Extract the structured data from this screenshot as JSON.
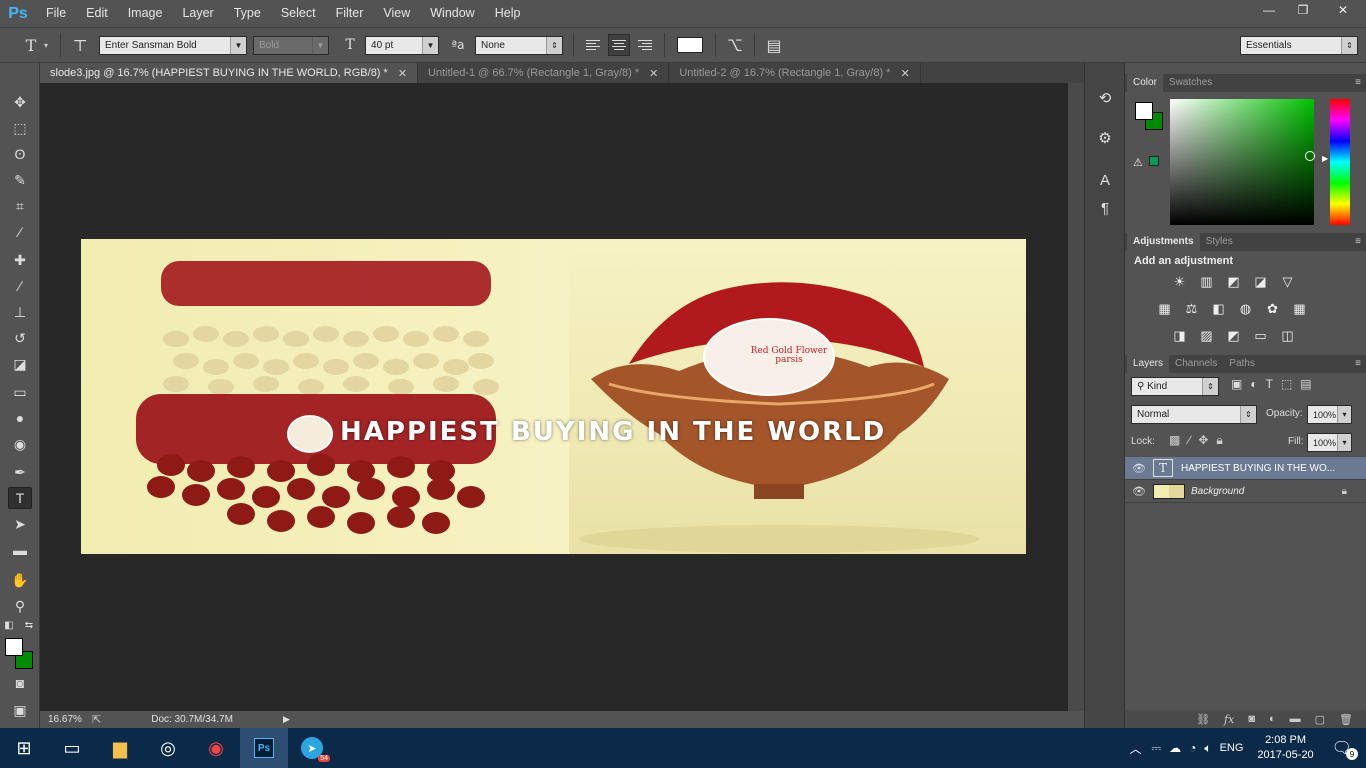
{
  "app": {
    "logo": "Ps"
  },
  "menu": [
    "File",
    "Edit",
    "Image",
    "Layer",
    "Type",
    "Select",
    "Filter",
    "View",
    "Window",
    "Help"
  ],
  "window_controls": {
    "minimize": "—",
    "restore": "❐",
    "close": "✕"
  },
  "options": {
    "font_family": "Enter Sansman Bold",
    "font_style": "Bold",
    "font_size": "40 pt",
    "anti_alias": "None",
    "workspace": "Essentials",
    "text_color": "#ffffff"
  },
  "tabs": [
    {
      "label": "slode3.jpg @ 16.7% (HAPPIEST BUYING IN THE WORLD, RGB/8) *",
      "close": "✕"
    },
    {
      "label": "Untitled-1 @ 66.7% (Rectangle 1, Gray/8) *",
      "close": "✕"
    },
    {
      "label": "Untitled-2 @ 16.7% (Rectangle 1, Gray/8) *",
      "close": "✕"
    }
  ],
  "document": {
    "headline": "HAPPIEST BUYING IN THE WORLD",
    "badge_text": "Red Gold Flower parsis"
  },
  "status": {
    "zoom": "16.67%",
    "doc": "Doc: 30.7M/34.7M"
  },
  "panels": {
    "color_tabs": [
      "Color",
      "Swatches"
    ],
    "adjust_tabs": [
      "Adjustments",
      "Styles"
    ],
    "adjust_title": "Add an adjustment",
    "layers_tabs": [
      "Layers",
      "Channels",
      "Paths"
    ],
    "kind": "Kind",
    "blend": "Normal",
    "opacity_label": "Opacity:",
    "opacity": "100%",
    "lock_label": "Lock:",
    "fill_label": "Fill:",
    "fill": "100%",
    "layers": [
      {
        "name": "HAPPIEST BUYING IN THE WO...",
        "type": "text"
      },
      {
        "name": "Background",
        "type": "image"
      }
    ]
  },
  "taskbar": {
    "time": "2:08 PM",
    "date": "2017-05-20",
    "lang": "ENG",
    "telegram_badge": "54",
    "notif_badge": "9"
  },
  "colors": {
    "fg": "#ffffff",
    "bg": "#008a00"
  }
}
